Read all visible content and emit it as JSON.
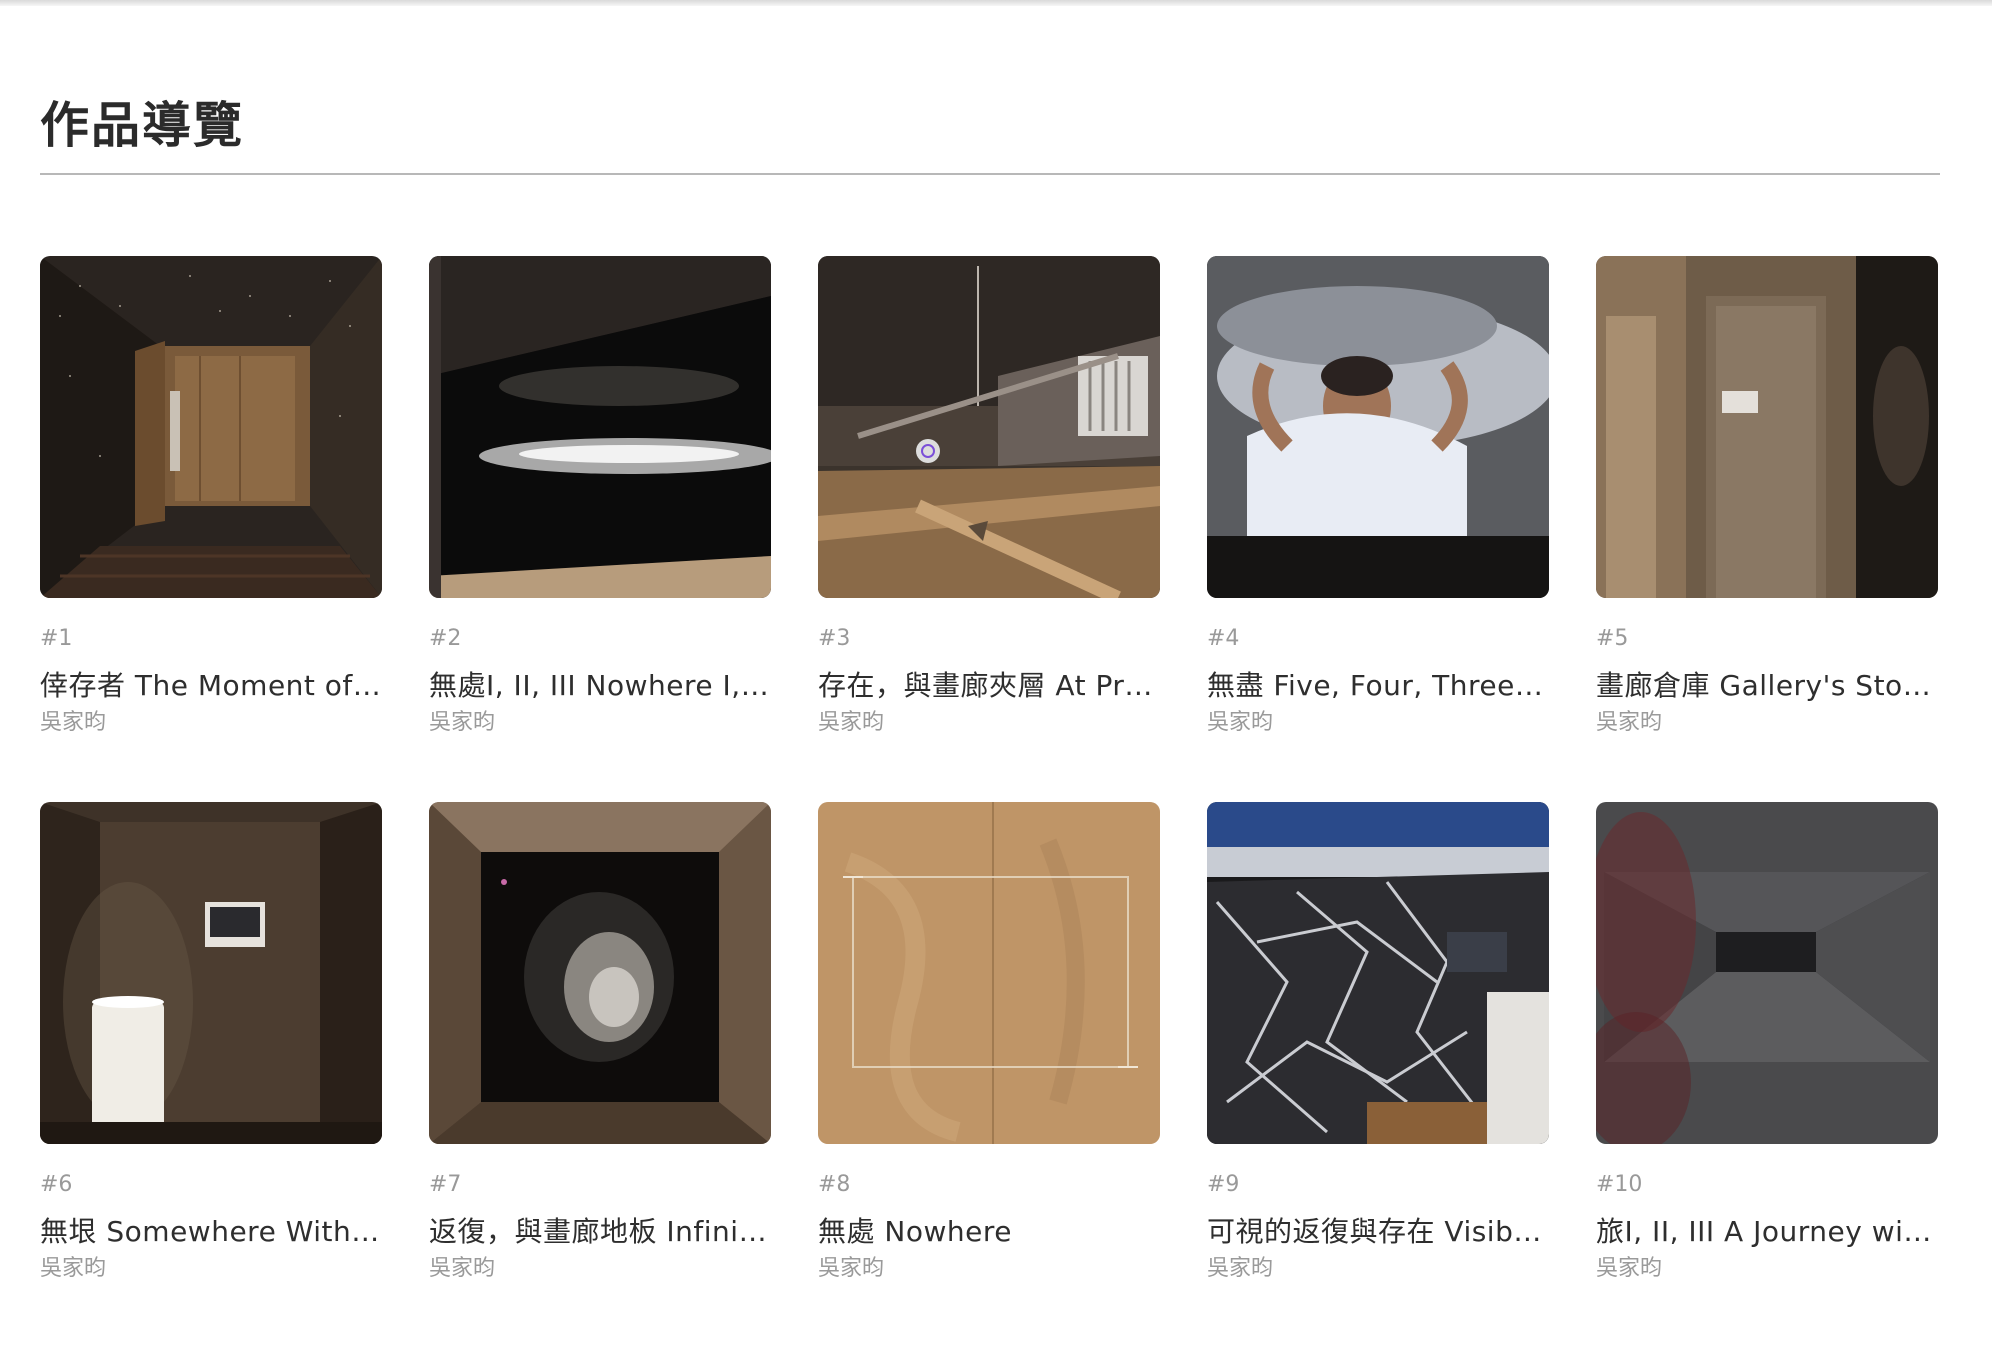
{
  "section": {
    "title": "作品導覽"
  },
  "works": [
    {
      "number": "#1",
      "title": "倖存者 The Moment of …",
      "artist": "吳家昀",
      "thumb": "corridor-wood-door"
    },
    {
      "number": "#2",
      "title": "無處I, II, III Nowhere I, I…",
      "artist": "吳家昀",
      "thumb": "projection-light-band"
    },
    {
      "number": "#3",
      "title": "存在，與畫廊夾層 At Pr…",
      "artist": "吳家昀",
      "thumb": "ceiling-mezzanine"
    },
    {
      "number": "#4",
      "title": "無盡 Five, Four, Three, T…",
      "artist": "吳家昀",
      "thumb": "man-lying-pillow"
    },
    {
      "number": "#5",
      "title": "畫廊倉庫 Gallery's Stor…",
      "artist": "吳家昀",
      "thumb": "storage-door"
    },
    {
      "number": "#6",
      "title": "無垠 Somewhere Without",
      "artist": "吳家昀",
      "thumb": "lamp-room"
    },
    {
      "number": "#7",
      "title": "返復，與畫廊地板 Infini…",
      "artist": "吳家昀",
      "thumb": "dark-box-moon"
    },
    {
      "number": "#8",
      "title": "無處 Nowhere",
      "artist": "吳家昀",
      "thumb": "plywood-wall"
    },
    {
      "number": "#9",
      "title": "可視的返復與存在 Visibl…",
      "artist": "吳家昀",
      "thumb": "plastic-wrap"
    },
    {
      "number": "#10",
      "title": "旅I, II, III A Journey wit…",
      "artist": "吳家昀",
      "thumb": "grey-corridor"
    }
  ]
}
